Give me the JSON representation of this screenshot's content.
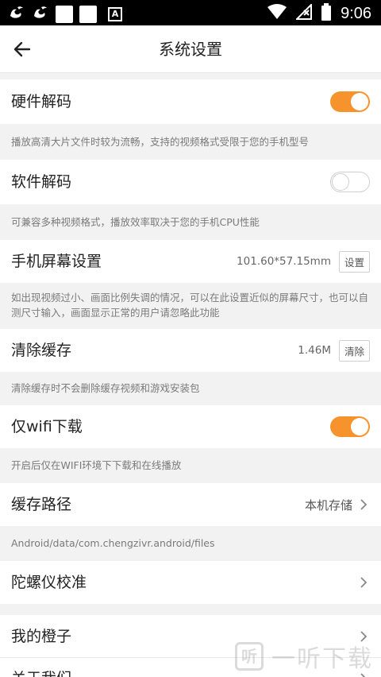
{
  "statusbar": {
    "time": "9:06",
    "icons": [
      "uc-browser-icon",
      "uc-browser-icon",
      "notification-box-icon",
      "notification-box-icon",
      "a-icon",
      "wifi-icon",
      "signal-off-icon",
      "battery-icon"
    ],
    "a_label": "A"
  },
  "header": {
    "title": "系统设置"
  },
  "settings": {
    "hw_decode": {
      "label": "硬件解码",
      "enabled": true,
      "desc": "播放高清大片文件时较为流畅，支持的视频格式受限于您的手机型号"
    },
    "sw_decode": {
      "label": "软件解码",
      "enabled": false,
      "desc": "可兼容多种视频格式，播放效率取决于您的手机CPU性能"
    },
    "screen": {
      "label": "手机屏幕设置",
      "value": "101.60*57.15mm",
      "button": "设置",
      "desc": "如出现视频过小、画面比例失调的情况，可以在此设置近似的屏幕尺寸，也可以自测尺寸输入，画面显示正常的用户请忽略此功能"
    },
    "cache": {
      "label": "清除缓存",
      "value": "1.46M",
      "button": "清除",
      "desc": "清除缓存时不会删除缓存视频和游戏安装包"
    },
    "wifi_only": {
      "label": "仅wifi下载",
      "enabled": true,
      "desc": "开启后仅在WIFI环境下下载和在线播放"
    },
    "cache_path": {
      "label": "缓存路径",
      "value": "本机存储",
      "desc": "Android/data/com.chengzivr.android/files"
    },
    "gyro": {
      "label": "陀螺仪校准"
    },
    "my_orange": {
      "label": "我的橙子"
    },
    "about": {
      "label": "关于我们"
    }
  },
  "watermark": {
    "mark": "听",
    "text": "一听下载"
  },
  "colors": {
    "accent": "#f7932c",
    "background": "#f2f2f2"
  }
}
